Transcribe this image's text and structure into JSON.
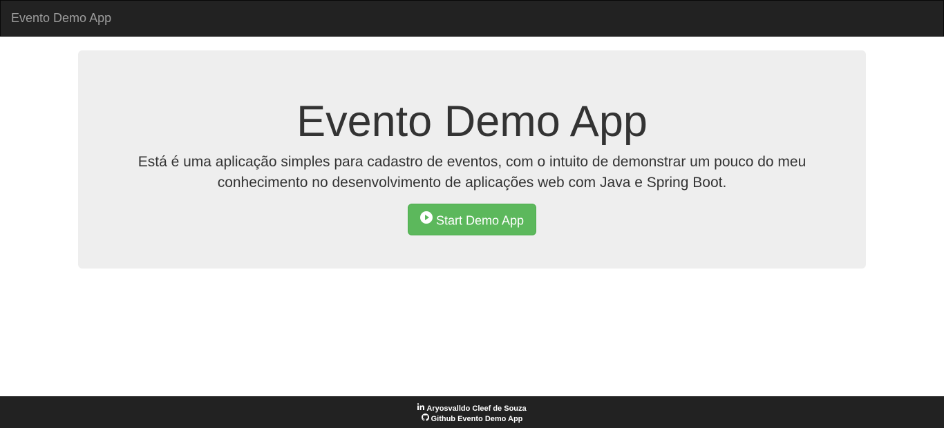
{
  "navbar": {
    "brand": "Evento Demo App"
  },
  "jumbotron": {
    "title": "Evento Demo App",
    "lead": "Está é uma aplicação simples para cadastro de eventos, com o intuito de demonstrar um pouco do meu conhecimento no desenvolvimento de aplicações web com Java e Spring Boot.",
    "button_label": "Start Demo App",
    "button_icon": "play-circle-icon"
  },
  "footer": {
    "linkedin_icon": "linkedin-icon",
    "linkedin_label": "Aryosvalldo Cleef de Souza",
    "github_icon": "github-icon",
    "github_label": "Github Evento Demo App"
  },
  "colors": {
    "navbar_bg": "#222222",
    "brand_text": "#9d9d9d",
    "jumbotron_bg": "#eeeeee",
    "button_success": "#5cb85c",
    "footer_bg": "#222222"
  }
}
